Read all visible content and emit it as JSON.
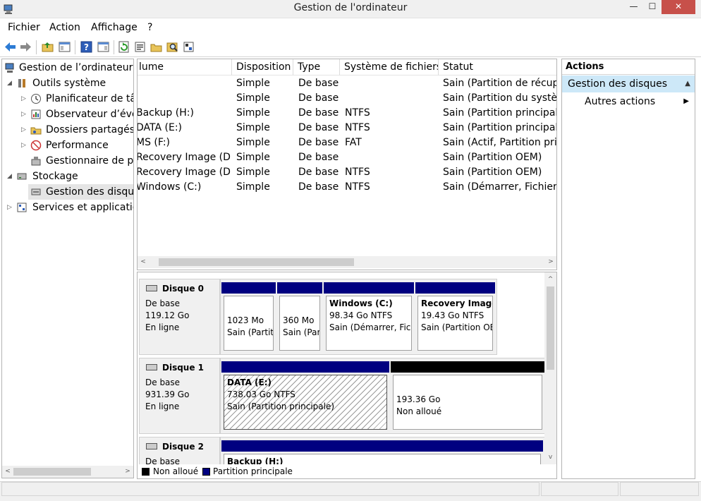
{
  "window": {
    "title": "Gestion de l'ordinateur",
    "min_glyph": "—",
    "max_glyph": "☐",
    "close_glyph": "✕"
  },
  "menu": [
    "Fichier",
    "Action",
    "Affichage",
    "?"
  ],
  "toolbar_icons": [
    "back-arrow-icon",
    "forward-arrow-icon",
    "up-folder-icon",
    "show-hide-tree-icon",
    "help-icon",
    "show-hide-action-pane-icon",
    "refresh-icon",
    "properties-icon",
    "open-folder-icon",
    "find-icon",
    "connect-icon"
  ],
  "tree": {
    "root": "Gestion de l’ordinateur (l",
    "items": [
      {
        "label": "Outils système",
        "level": 1,
        "arrow": "◢"
      },
      {
        "label": "Planificateur de tâc",
        "level": 2,
        "arrow": "▷"
      },
      {
        "label": "Observateur d’évér",
        "level": 2,
        "arrow": "▷"
      },
      {
        "label": "Dossiers partagés",
        "level": 2,
        "arrow": "▷"
      },
      {
        "label": "Performance",
        "level": 2,
        "arrow": "▷"
      },
      {
        "label": "Gestionnaire de pé",
        "level": 2,
        "arrow": ""
      },
      {
        "label": "Stockage",
        "level": 1,
        "arrow": "◢"
      },
      {
        "label": "Gestion des disque",
        "level": 2,
        "arrow": "",
        "selected": true
      },
      {
        "label": "Services et application",
        "level": 1,
        "arrow": "▷"
      }
    ]
  },
  "volumes": {
    "columns": [
      "lume",
      "Disposition",
      "Type",
      "Système de fichiers",
      "Statut"
    ],
    "rows": [
      {
        "volume": "",
        "disposition": "Simple",
        "type": "De base",
        "fs": "",
        "status": "Sain (Partition de récupé"
      },
      {
        "volume": "",
        "disposition": "Simple",
        "type": "De base",
        "fs": "",
        "status": "Sain (Partition du systèm"
      },
      {
        "volume": "Backup (H:)",
        "disposition": "Simple",
        "type": "De base",
        "fs": "NTFS",
        "status": "Sain (Partition principale"
      },
      {
        "volume": "DATA (E:)",
        "disposition": "Simple",
        "type": "De base",
        "fs": "NTFS",
        "status": "Sain (Partition principale"
      },
      {
        "volume": "MS (F:)",
        "disposition": "Simple",
        "type": "De base",
        "fs": "FAT",
        "status": "Sain (Actif, Partition prin"
      },
      {
        "volume": "Recovery Image (D:)",
        "disposition": "Simple",
        "type": "De base",
        "fs": "",
        "status": "Sain (Partition OEM)"
      },
      {
        "volume": "Recovery Image (D:)",
        "disposition": "Simple",
        "type": "De base",
        "fs": "NTFS",
        "status": "Sain (Partition OEM)"
      },
      {
        "volume": "Windows (C:)",
        "disposition": "Simple",
        "type": "De base",
        "fs": "NTFS",
        "status": "Sain (Démarrer, Fichier d"
      }
    ]
  },
  "disks": [
    {
      "name": "Disque 0",
      "kind": "De base",
      "size": "119.12 Go",
      "state": "En ligne",
      "partitions": [
        {
          "name": "",
          "size": "1023 Mo",
          "status": "Sain (Partit"
        },
        {
          "name": "",
          "size": "360 Mo",
          "status": "Sain (Par"
        },
        {
          "name": "Windows  (C:)",
          "size": "98.34 Go NTFS",
          "status": "Sain (Démarrer, Fich"
        },
        {
          "name": "Recovery Image",
          "size": "19.43 Go NTFS",
          "status": "Sain (Partition OE"
        }
      ]
    },
    {
      "name": "Disque 1",
      "kind": "De base",
      "size": "931.39 Go",
      "state": "En ligne",
      "partitions": [
        {
          "name": "DATA  (E:)",
          "size": "738.03 Go NTFS",
          "status": "Sain (Partition principale)"
        },
        {
          "name": "",
          "size": "193.36 Go",
          "status": "Non alloué"
        }
      ]
    },
    {
      "name": "Disque 2",
      "kind": "De base",
      "size": "",
      "state": "",
      "partitions": [
        {
          "name": "Backup  (H:)",
          "size": "",
          "status": ""
        }
      ]
    }
  ],
  "legend": [
    {
      "label": "Non alloué",
      "color": "#000000"
    },
    {
      "label": "Partition principale",
      "color": "#000080"
    }
  ],
  "actions": {
    "header": "Actions",
    "section": "Gestion des disques",
    "item": "Autres actions",
    "section_color": "#cde8f8"
  },
  "scroll": {
    "left_glyph": "<",
    "right_glyph": ">",
    "up_glyph": "^",
    "down_glyph": "v"
  }
}
